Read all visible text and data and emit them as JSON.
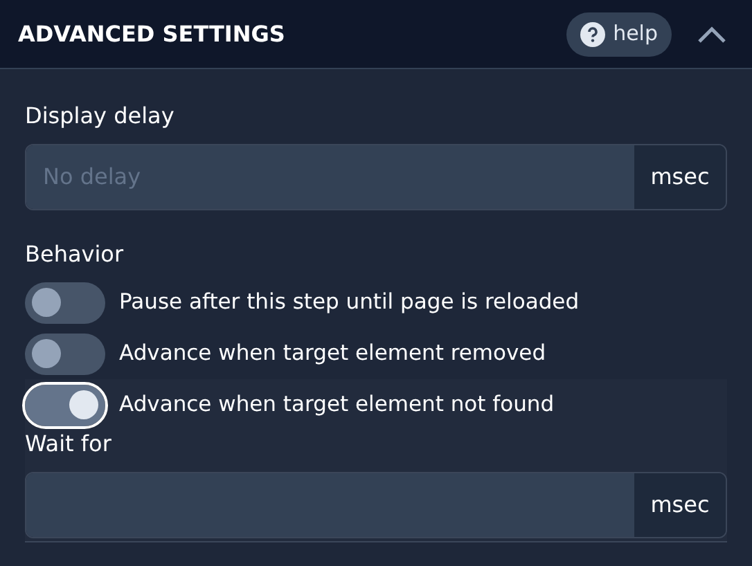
{
  "header": {
    "title": "ADVANCED SETTINGS",
    "help_label": "help",
    "expanded": true
  },
  "display_delay": {
    "label": "Display delay",
    "placeholder": "No delay",
    "unit": "msec"
  },
  "behavior": {
    "label": "Behavior",
    "options": [
      {
        "label": "Pause after this step until page is reloaded",
        "on": false,
        "focused": false
      },
      {
        "label": "Advance when target element removed",
        "on": false,
        "focused": false
      },
      {
        "label": "Advance when target element not found",
        "on": true,
        "focused": true
      }
    ]
  },
  "wait_for": {
    "label": "Wait for",
    "unit": "msec"
  }
}
